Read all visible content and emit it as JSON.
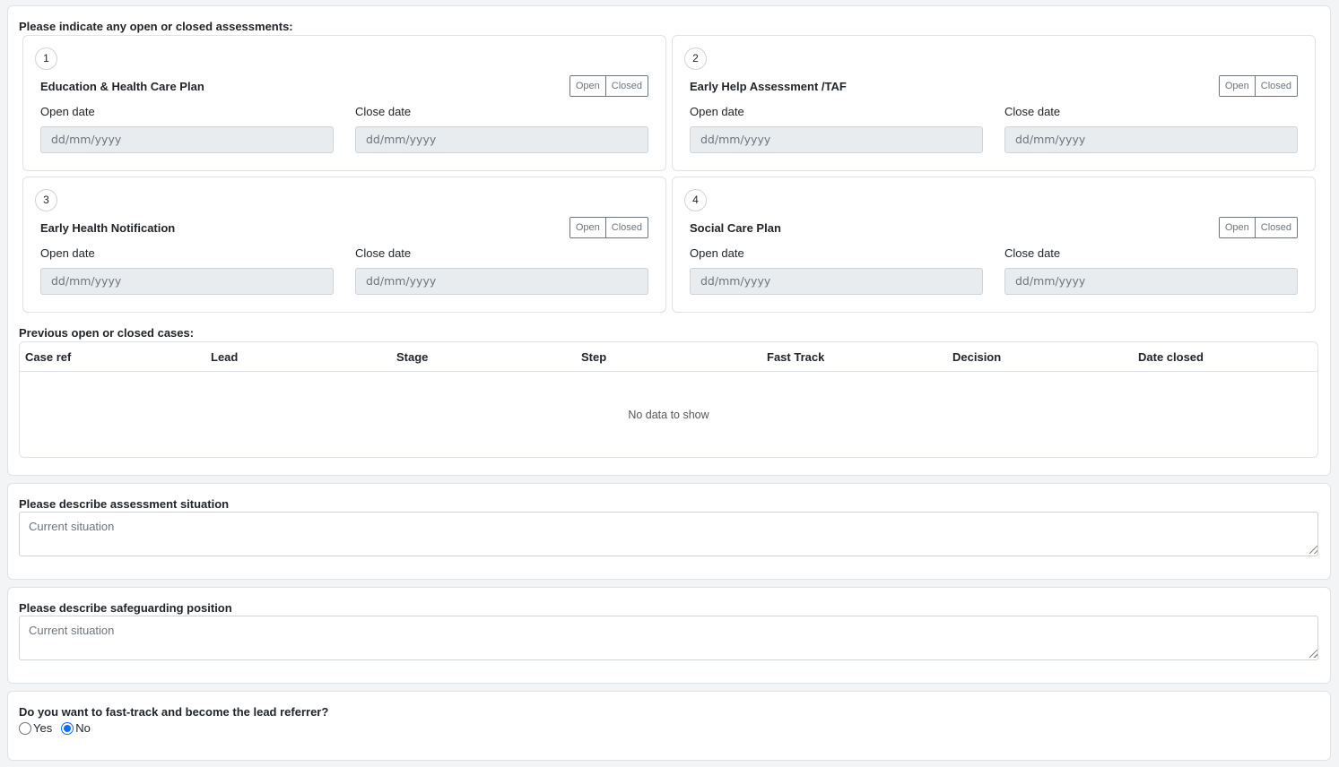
{
  "assessments": {
    "label": "Please indicate any open or closed assessments:",
    "cards": [
      {
        "number": "1",
        "title": "Education & Health Care Plan",
        "open_btn": "Open",
        "closed_btn": "Closed",
        "open_date_label": "Open date",
        "close_date_label": "Close date",
        "open_date_value": "dd/mm/yyyy",
        "close_date_value": "dd/mm/yyyy"
      },
      {
        "number": "2",
        "title": "Early Help Assessment /TAF",
        "open_btn": "Open",
        "closed_btn": "Closed",
        "open_date_label": "Open date",
        "close_date_label": "Close date",
        "open_date_value": "dd/mm/yyyy",
        "close_date_value": "dd/mm/yyyy"
      },
      {
        "number": "3",
        "title": "Early Health Notification",
        "open_btn": "Open",
        "closed_btn": "Closed",
        "open_date_label": "Open date",
        "close_date_label": "Close date",
        "open_date_value": "dd/mm/yyyy",
        "close_date_value": "dd/mm/yyyy"
      },
      {
        "number": "4",
        "title": "Social Care Plan",
        "open_btn": "Open",
        "closed_btn": "Closed",
        "open_date_label": "Open date",
        "close_date_label": "Close date",
        "open_date_value": "dd/mm/yyyy",
        "close_date_value": "dd/mm/yyyy"
      }
    ]
  },
  "cases": {
    "label": "Previous open or closed cases:",
    "columns": [
      "Case ref",
      "Lead",
      "Stage",
      "Step",
      "Fast Track",
      "Decision",
      "Date closed"
    ],
    "empty_message": "No data to show"
  },
  "assessment_situation": {
    "label": "Please describe assessment situation",
    "placeholder": "Current situation"
  },
  "safeguarding": {
    "label": "Please describe safeguarding position",
    "placeholder": "Current situation"
  },
  "fast_track": {
    "question": "Do you want to fast-track and become the lead referrer?",
    "options": [
      {
        "label": "Yes",
        "checked": false
      },
      {
        "label": "No",
        "checked": true
      }
    ]
  },
  "colors": {
    "accent": "#0d6efd",
    "input_bg": "#e9ecef",
    "border": "#dfe3e7"
  }
}
